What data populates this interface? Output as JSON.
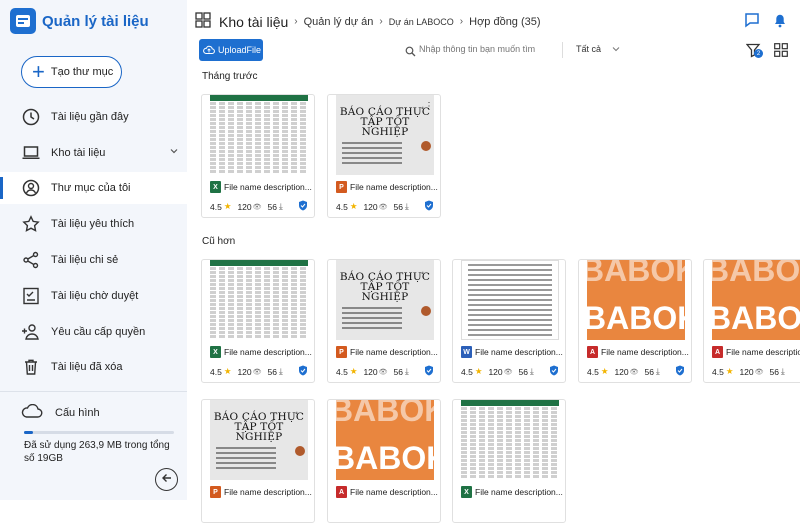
{
  "app": {
    "title": "Quản lý tài liệu"
  },
  "sidebar": {
    "new_button": "Tạo thư mục",
    "items": [
      {
        "label": "Tài liệu gần đây",
        "icon": "clock-icon"
      },
      {
        "label": "Kho  tài liệu",
        "icon": "laptop-icon"
      },
      {
        "label": "Thư mục  của tôi",
        "icon": "user-circle-icon"
      },
      {
        "label": "Tài liệu yêu thích",
        "icon": "star-icon"
      },
      {
        "label": "Tài liệu chi sẻ",
        "icon": "share-icon"
      },
      {
        "label": "Tài liệu chờ duyệt",
        "icon": "checklist-icon"
      },
      {
        "label": "Yêu cầu cấp quyền",
        "icon": "add-user-icon"
      },
      {
        "label": "Tài liệu đã xóa",
        "icon": "trash-icon"
      }
    ],
    "config_label": "Cấu hình",
    "storage": {
      "used_fraction": 0.06,
      "text": "Đã sử dụng 263,9 MB trong tổng số 19GB"
    }
  },
  "breadcrumb": [
    "Kho tài liệu",
    "Quản lý dự án",
    "Dự án LABOCO",
    "Hợp đồng (35)"
  ],
  "toolbar": {
    "upload_label": "UploadFile",
    "search_placeholder": "Nhập thông tin bạn muốn tìm",
    "filter_value": "Tất cả",
    "filter_badge": "2"
  },
  "sections": [
    {
      "title": "Tháng trước"
    },
    {
      "title": "Cũ hơn"
    }
  ],
  "report_title": "BÁO CÁO THỰC TẬP TỐT NGHIỆP",
  "orange_text_top": "BABOK",
  "orange_text_bottom": "BABOK",
  "cards": [
    {
      "name": "File name description...",
      "type": "xls",
      "rating": "4.5",
      "views": "120",
      "downloads": "56"
    },
    {
      "name": "File name description...",
      "type": "ppt",
      "rating": "4.5",
      "views": "120",
      "downloads": "56"
    },
    {
      "name": "File name description...",
      "type": "xls",
      "rating": "4.5",
      "views": "120",
      "downloads": "56"
    },
    {
      "name": "File name description...",
      "type": "ppt",
      "rating": "4.5",
      "views": "120",
      "downloads": "56"
    },
    {
      "name": "File name description...",
      "type": "doc",
      "rating": "4.5",
      "views": "120",
      "downloads": "56"
    },
    {
      "name": "File name description...",
      "type": "pdf",
      "rating": "4.5",
      "views": "120",
      "downloads": "56"
    },
    {
      "name": "File name description...",
      "type": "pdf",
      "rating": "4.5",
      "views": "120",
      "downloads": "56"
    },
    {
      "name": "File name description...",
      "type": "ppt",
      "rating": "",
      "views": "",
      "downloads": ""
    },
    {
      "name": "File name description...",
      "type": "pdf",
      "rating": "",
      "views": "",
      "downloads": ""
    },
    {
      "name": "File name description...",
      "type": "xls",
      "rating": "",
      "views": "",
      "downloads": ""
    }
  ],
  "colors": {
    "primary": "#1e6fd0",
    "xls": "#1f7244",
    "ppt": "#d35a1f",
    "doc": "#2b5fb8",
    "pdf": "#c62b2b",
    "orange_thumb": "#e9863f"
  }
}
